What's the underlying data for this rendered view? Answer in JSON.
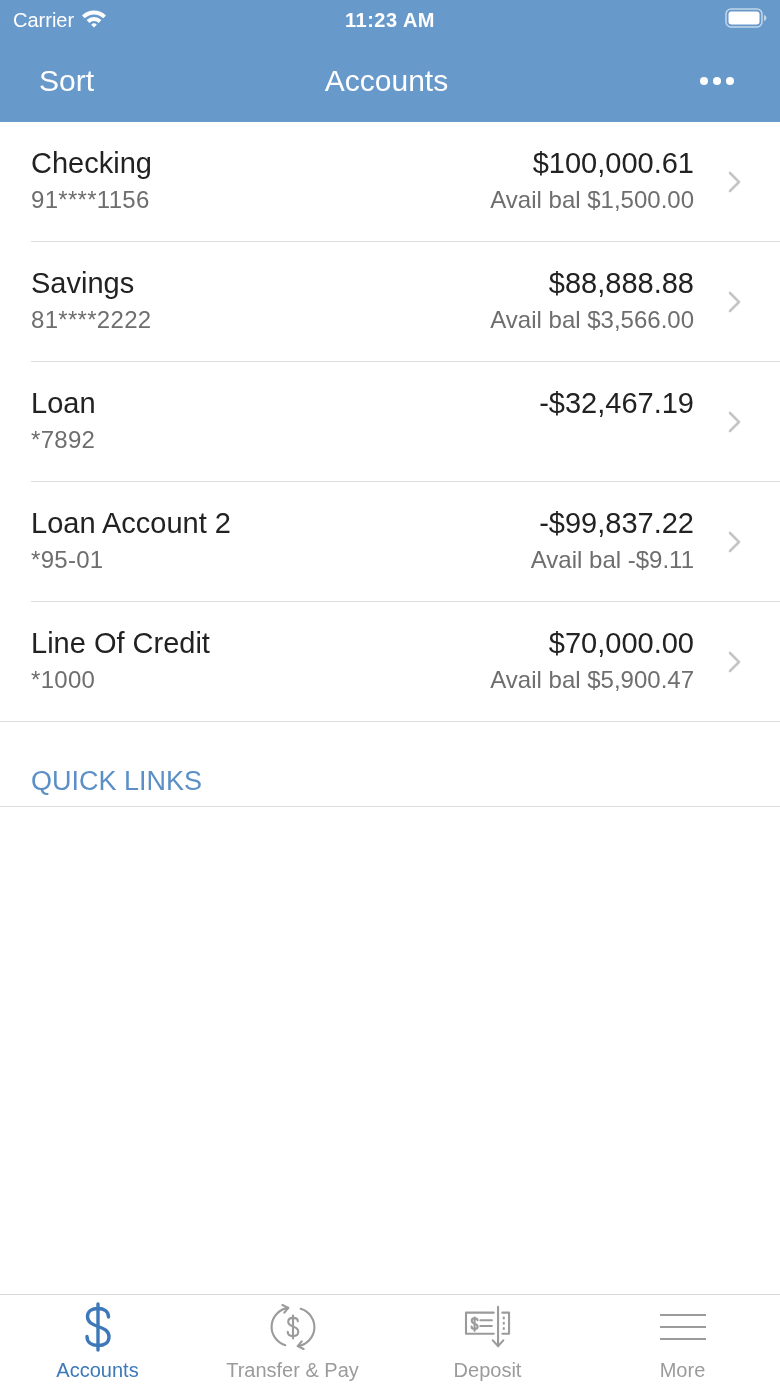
{
  "status_bar": {
    "carrier": "Carrier",
    "time": "11:23 AM"
  },
  "nav_bar": {
    "left_button": "Sort",
    "title": "Accounts"
  },
  "accounts": [
    {
      "name": "Checking",
      "number": "91****1156",
      "balance": "$100,000.61",
      "available": "Avail bal $1,500.00"
    },
    {
      "name": "Savings",
      "number": "81****2222",
      "balance": "$88,888.88",
      "available": "Avail bal $3,566.00"
    },
    {
      "name": "Loan",
      "number": "*7892",
      "balance": "-$32,467.19"
    },
    {
      "name": "Loan Account 2",
      "number": "*95-01",
      "balance": "-$99,837.22",
      "available": "Avail bal -$9.11"
    },
    {
      "name": "Line Of Credit",
      "number": "*1000",
      "balance": "$70,000.00",
      "available": "Avail bal $5,900.47"
    }
  ],
  "quick_links": {
    "heading": "QUICK LINKS"
  },
  "tab_bar": [
    {
      "kind": "dollar",
      "label": "Accounts",
      "selected": true
    },
    {
      "kind": "transfer",
      "label": "Transfer & Pay",
      "selected": false
    },
    {
      "kind": "deposit",
      "label": "Deposit",
      "selected": false
    },
    {
      "kind": "menu",
      "label": "More",
      "selected": false
    }
  ]
}
